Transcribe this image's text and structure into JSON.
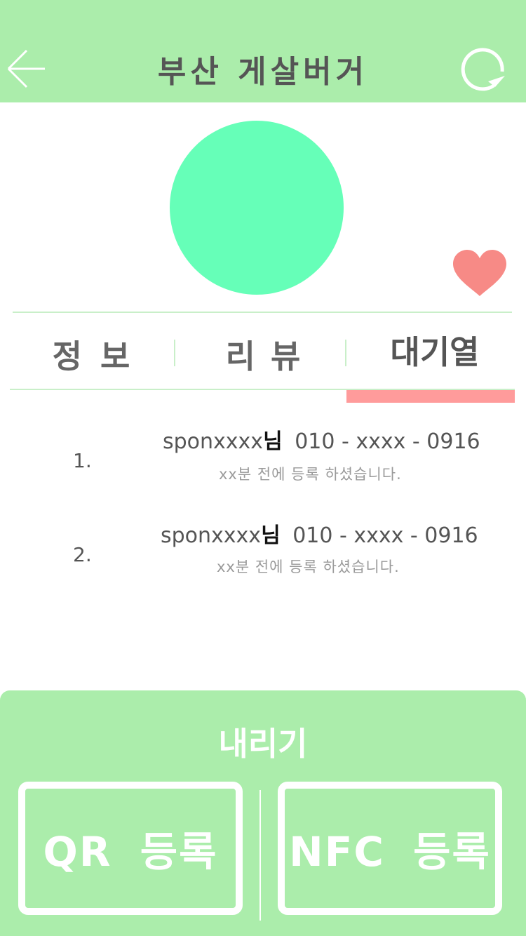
{
  "header": {
    "title": "부산 게살버거",
    "back_icon": "arrow-left-icon",
    "refresh_icon": "refresh-icon"
  },
  "profile": {
    "avatar_color": "#66ffb8",
    "favorite_icon": "heart-icon",
    "favorite_color": "#f78a86"
  },
  "tabs": [
    {
      "label": "정보",
      "active": false
    },
    {
      "label": "리뷰",
      "active": false
    },
    {
      "label": "대기열",
      "active": true
    }
  ],
  "queue": [
    {
      "number": "1.",
      "name": "sponxxxx",
      "suffix": "님",
      "phone": "010 - xxxx - 0916",
      "note": "xx분 전에 등록 하셨습니다."
    },
    {
      "number": "2.",
      "name": "sponxxxx",
      "suffix": "님",
      "phone": "010 - xxxx - 0916",
      "note": "xx분 전에 등록 하셨습니다."
    }
  ],
  "bottom_panel": {
    "pull_label": "내리기",
    "qr_button": "QR 등록",
    "nfc_button": "NFC 등록"
  },
  "colors": {
    "accent_green": "#abedab",
    "tab_indicator": "#ff9b9b",
    "text_dark": "#555555",
    "text_muted": "#9a9a9a"
  }
}
